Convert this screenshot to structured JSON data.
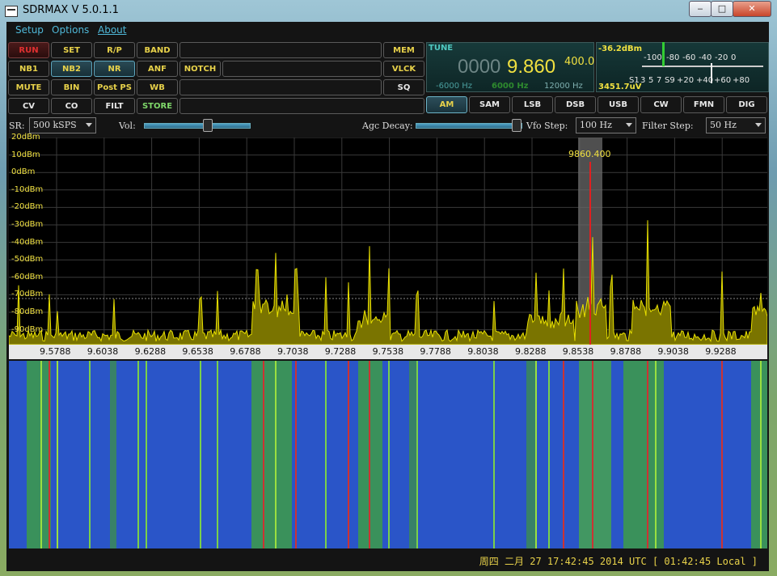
{
  "window": {
    "title": "SDRMAX V 5.0.1.1",
    "minimize": "‒",
    "maximize": "□",
    "close": "✕"
  },
  "menu": [
    "Setup",
    "Options",
    "About"
  ],
  "buttons": {
    "row1": [
      "RUN",
      "SET",
      "R/P",
      "BAND"
    ],
    "row1_right": "MEM",
    "row2": [
      "NB1",
      "NB2",
      "NR",
      "ANF",
      "NOTCH"
    ],
    "row2_right": "VLCK",
    "row3": [
      "MUTE",
      "BIN",
      "Post PS",
      "WB"
    ],
    "row3_right": "SQ",
    "row4": [
      "CV",
      "CO",
      "FILT",
      "STORE"
    ]
  },
  "tune": {
    "label": "TUNE",
    "freq_dim": "0000",
    "freq_main": "9.860",
    "freq_sub": "400.0",
    "filter_low": "-6000 Hz",
    "filter_mid": "6000 Hz",
    "filter_width": "12000 Hz"
  },
  "smeter": {
    "level": "-36.2dBm",
    "uv": "3451.7uV",
    "top_scale": [
      "-100",
      "-80",
      "-60",
      "-40",
      "-20",
      "0"
    ],
    "bottom_scale": [
      "S1",
      "3",
      "5",
      "7",
      "S9",
      "+20",
      "+40",
      "+60",
      "+80"
    ]
  },
  "modes": [
    "AM",
    "SAM",
    "LSB",
    "DSB",
    "USB",
    "CW",
    "FMN",
    "DIG"
  ],
  "selected_mode": "AM",
  "controls": {
    "sr_label": "SR:",
    "sr_value": "500 kSPS",
    "vol_label": "Vol:",
    "vol_level": 0.6,
    "agc_label": "Agc Decay:",
    "agc_level": 0.95,
    "vfo_label": "Vfo Step:",
    "vfo_value": "100 Hz",
    "filter_label": "Filter Step:",
    "filter_value": "50 Hz"
  },
  "spectrum": {
    "db_labels": [
      "20dBm",
      "10dBm",
      "0dBm",
      "-10dBm",
      "-20dBm",
      "-30dBm",
      "-40dBm",
      "-50dBm",
      "-60dBm",
      "-70dBm",
      "-80dBm",
      "-90dBm"
    ],
    "marker_label": "9860.400",
    "freq_labels": [
      "9.5788",
      "9.6038",
      "9.6288",
      "9.6538",
      "9.6788",
      "9.7038",
      "9.7288",
      "9.7538",
      "9.7788",
      "9.8038",
      "9.8288",
      "9.8538",
      "9.8788",
      "9.9038",
      "9.9288"
    ]
  },
  "status": "周四 二月 27 17:42:45 2014 UTC [ 01:42:45 Local ]",
  "colors": {
    "trace": "#e8e000",
    "marker": "#e02020",
    "waterfall_bg": "#2a55c8",
    "accent": "#4fb8d8"
  }
}
